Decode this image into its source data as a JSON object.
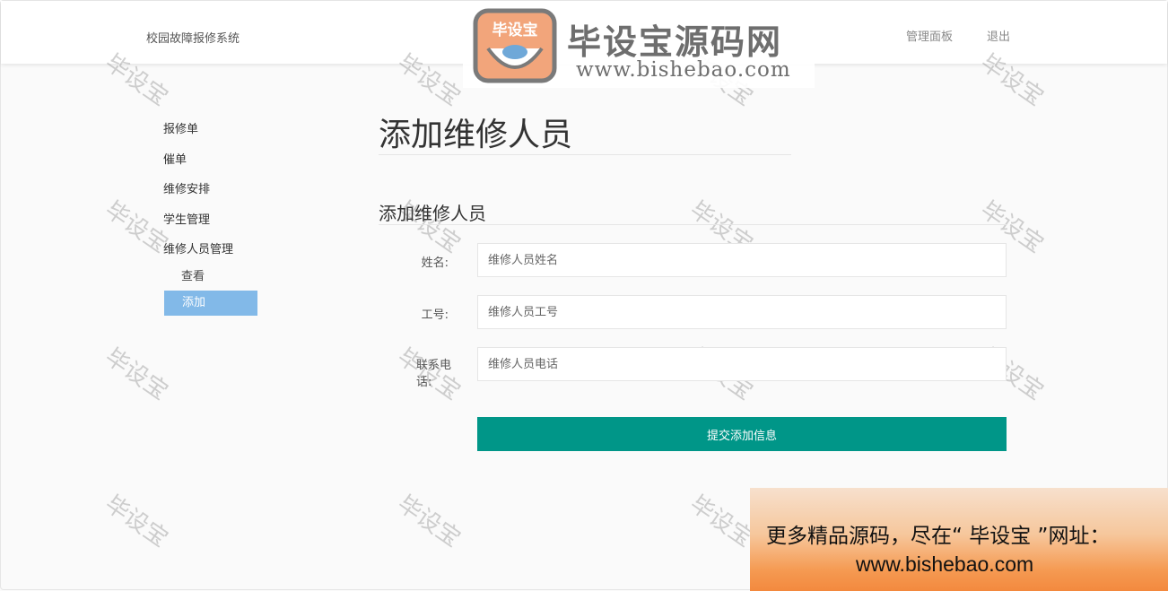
{
  "navbar": {
    "brand": "校园故障报修系统",
    "dashboard": "管理面板",
    "logout": "退出"
  },
  "logo": {
    "badge_text": "毕设宝",
    "title": "毕设宝源码网",
    "url": "www.bishebao.com"
  },
  "sidebar": {
    "items": [
      {
        "label": "报修单"
      },
      {
        "label": "催单"
      },
      {
        "label": "维修安排"
      },
      {
        "label": "学生管理"
      },
      {
        "label": "维修人员管理"
      }
    ],
    "sub_items": [
      {
        "label": "查看"
      },
      {
        "label": "添加"
      }
    ]
  },
  "main": {
    "page_title": "添加维修人员",
    "section_title": "添加维修人员",
    "fields": [
      {
        "label": "姓名:",
        "placeholder": "维修人员姓名"
      },
      {
        "label": "工号:",
        "placeholder": "维修人员工号"
      },
      {
        "label": "联系电话:",
        "placeholder": "维修人员电话"
      }
    ],
    "submit": "提交添加信息"
  },
  "watermark": "毕设宝",
  "promo": {
    "line1": "更多精品源码，尽在“ 毕设宝 ”网址：",
    "line2": "www.bishebao.com"
  },
  "colors": {
    "primary_button": "#009688",
    "active_menu": "#82b9e8"
  }
}
